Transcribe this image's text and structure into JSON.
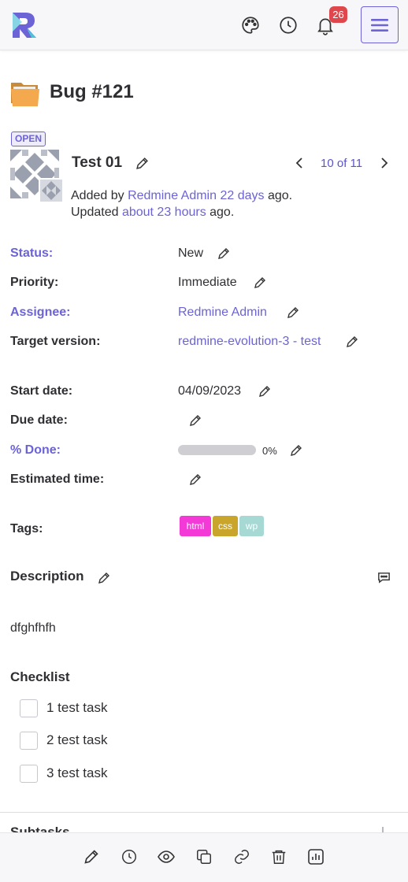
{
  "topbar": {
    "logo_icon": "redmine-logo",
    "icons": [
      "palette-icon",
      "clock-icon",
      "bell-icon"
    ],
    "notification_count": "26",
    "menu_icon": "hamburger-icon"
  },
  "issue": {
    "title": "Bug #121",
    "status_badge": "OPEN",
    "subject": "Test 01",
    "pagination": "10 of 11",
    "added_prefix": "Added by ",
    "author": "Redmine Admin",
    "created_ago": "22 days",
    "mid_text": " ago. Updated ",
    "updated_ago": "about 23 hours",
    "suffix": " ago."
  },
  "attributes": {
    "status": {
      "label": "Status:",
      "value": "New"
    },
    "priority": {
      "label": "Priority:",
      "value": "Immediate"
    },
    "assignee": {
      "label": "Assignee:",
      "value": "Redmine Admin"
    },
    "target_version": {
      "label": "Target version:",
      "value": "redmine-evolution-3 - test"
    },
    "start_date": {
      "label": "Start date:",
      "value": "04/09/2023"
    },
    "due_date": {
      "label": "Due date:",
      "value": ""
    },
    "done": {
      "label": "% Done:",
      "value": "0%",
      "percent": 0
    },
    "estimated_time": {
      "label": "Estimated time:",
      "value": ""
    },
    "tags": {
      "label": "Tags:",
      "items": [
        {
          "name": "html",
          "color": "#f43ad6"
        },
        {
          "name": "css",
          "color": "#c9a52c"
        },
        {
          "name": "wp",
          "color": "#a6d8d4"
        }
      ]
    }
  },
  "description": {
    "title": "Description",
    "text": "dfghfhfh"
  },
  "checklist": {
    "title": "Checklist",
    "items": [
      "1 test task",
      "2 test task",
      "3 test task"
    ]
  },
  "subtasks": {
    "title": "Subtasks"
  },
  "bottombar": {
    "icons": [
      "edit-icon",
      "history-icon",
      "watch-icon",
      "copy-icon",
      "link-icon",
      "delete-icon",
      "stats-icon"
    ]
  },
  "colors": {
    "accent": "#6b63d6",
    "badge": "#e0474c",
    "folder": "#f5a94e"
  }
}
